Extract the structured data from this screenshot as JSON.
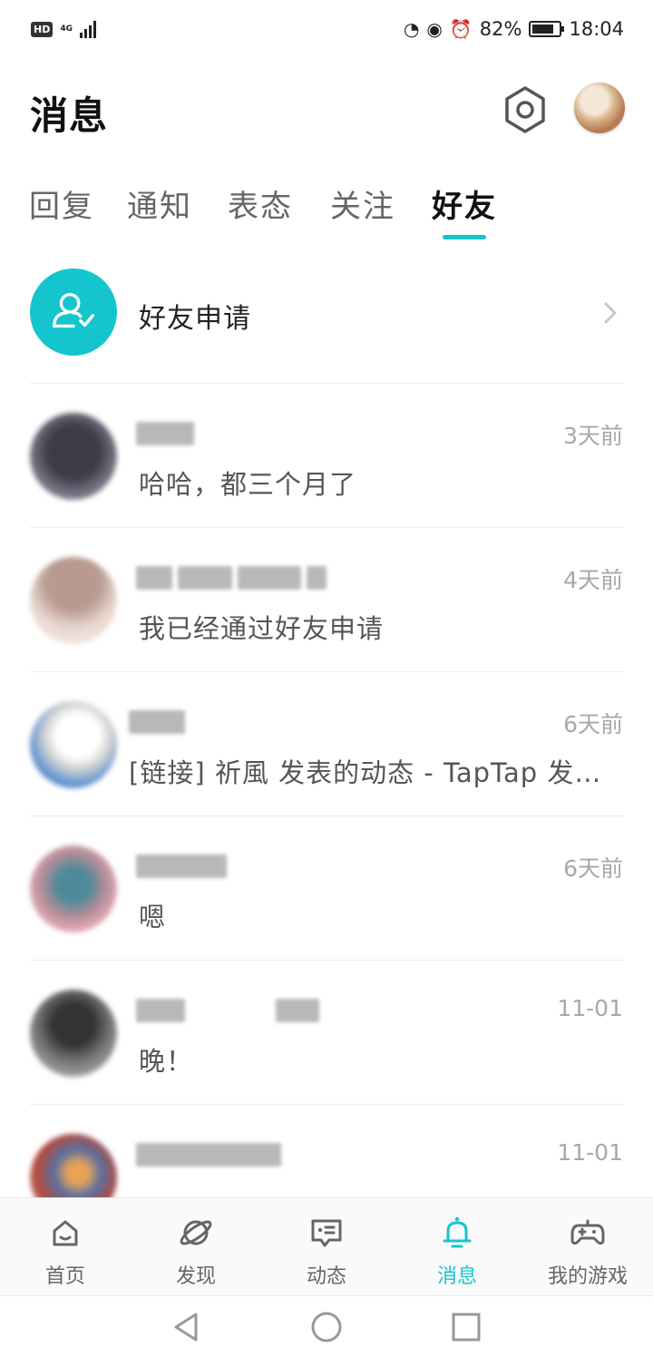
{
  "status_bar": {
    "hd": "HD",
    "network": "4G",
    "battery": "82%",
    "battery_level": 0.82,
    "time": "18:04"
  },
  "header": {
    "title": "消息"
  },
  "tabs": [
    {
      "label": "回复",
      "active": false
    },
    {
      "label": "通知",
      "active": false
    },
    {
      "label": "表态",
      "active": false
    },
    {
      "label": "关注",
      "active": false
    },
    {
      "label": "好友",
      "active": true
    }
  ],
  "friend_request": {
    "label": "好友申请"
  },
  "messages": [
    {
      "time": "3天前",
      "preview": "哈哈，都三个月了"
    },
    {
      "time": "4天前",
      "preview": "我已经通过好友申请"
    },
    {
      "time": "6天前",
      "preview": "[链接] 祈風 发表的动态 - TapTap 发现好游戏"
    },
    {
      "time": "6天前",
      "preview": "嗯"
    },
    {
      "time": "11-01",
      "preview": "晚！"
    },
    {
      "time": "11-01",
      "preview": ""
    }
  ],
  "bottom_nav": [
    {
      "label": "首页",
      "icon": "home-icon",
      "active": false
    },
    {
      "label": "发现",
      "icon": "planet-icon",
      "active": false
    },
    {
      "label": "动态",
      "icon": "feed-icon",
      "active": false
    },
    {
      "label": "消息",
      "icon": "bell-icon",
      "active": true
    },
    {
      "label": "我的游戏",
      "icon": "gamepad-icon",
      "active": false
    }
  ],
  "colors": {
    "accent": "#15c5ce",
    "text_primary": "#222222",
    "text_secondary": "#555555",
    "time": "#a8a8a8"
  }
}
